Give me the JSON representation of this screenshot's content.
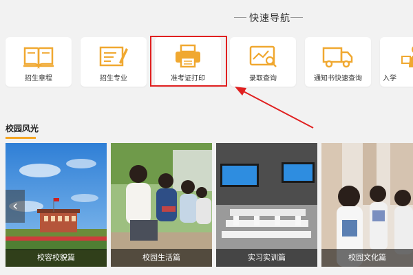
{
  "quick_nav": {
    "title": "快速导航",
    "items": [
      {
        "label": "招生章程",
        "icon": "book-icon"
      },
      {
        "label": "招生专业",
        "icon": "certificate-icon"
      },
      {
        "label": "准考证打印",
        "icon": "printer-icon"
      },
      {
        "label": "录取查询",
        "icon": "search-result-icon"
      },
      {
        "label": "通知书快速查询",
        "icon": "truck-icon"
      },
      {
        "label": "入学",
        "icon": "person-icon"
      }
    ]
  },
  "campus": {
    "title": "校园风光",
    "prev_arrow": "‹",
    "photos": [
      {
        "caption": "校容校貌篇"
      },
      {
        "caption": "校园生活篇"
      },
      {
        "caption": "实习实训篇"
      },
      {
        "caption": "校园文化篇"
      }
    ]
  },
  "colors": {
    "accent": "#f5a623",
    "icon_orange": "#f0a830",
    "highlight_red": "#e02020",
    "background": "#f2f2f2"
  }
}
